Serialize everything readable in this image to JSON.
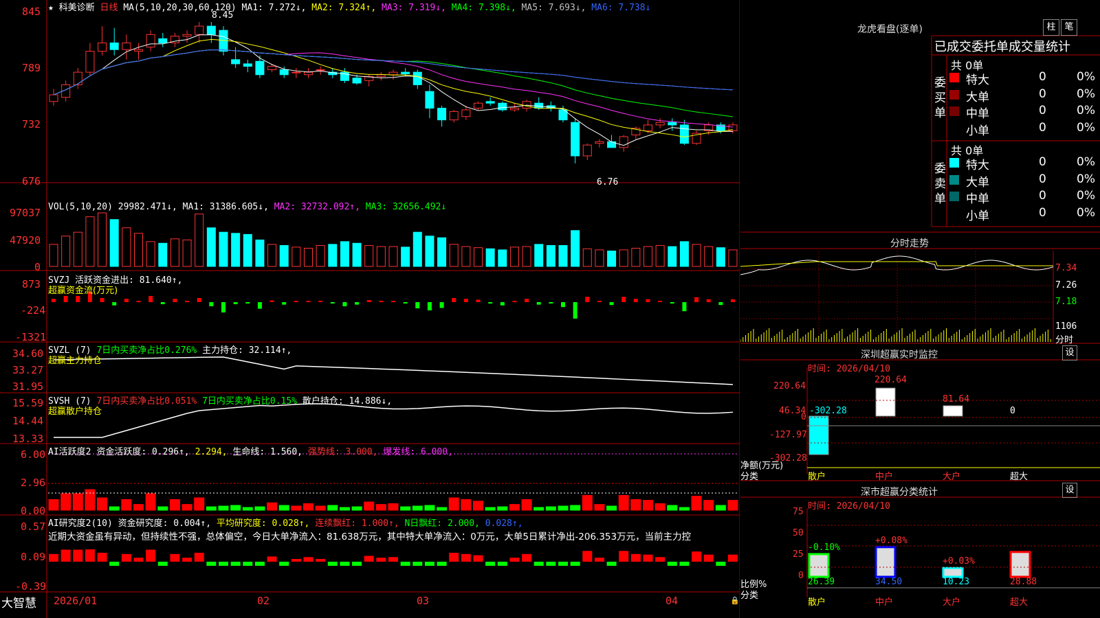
{
  "header": {
    "star": "★",
    "stock_name": "科美诊断",
    "period": "日线",
    "ma_label": "MA(5,10,20,30,60,120)",
    "ma1": "MA1: 7.272↓,",
    "ma2": "MA2: 7.324↑,",
    "ma3": "MA3: 7.319↓,",
    "ma4": "MA4: 7.398↓,",
    "ma5": "MA5: 7.693↓,",
    "ma6": "MA6: 7.738↓"
  },
  "price_axis": [
    "845",
    "789",
    "732",
    "676"
  ],
  "price_annotations": {
    "high": "8.45",
    "low": "6.76"
  },
  "vol": {
    "label": "VOL(5,10,20)",
    "value": "29982.471↓,",
    "ma1": "MA1: 31386.605↓,",
    "ma2": "MA2: 32732.092↑,",
    "ma3": "MA3: 32656.492↓",
    "axis": [
      "97037",
      "47920",
      "0"
    ]
  },
  "svzj": {
    "label": "SVZJ",
    "text1": "活跃资金进出: 81.640↑,",
    "text2": "超赢资金流(万元)",
    "axis": [
      "873",
      "-224",
      "-1321"
    ]
  },
  "svzl": {
    "label": "SVZL (7)",
    "text1": "7日内买卖净占比0.276%",
    "text2": "主力持仓: 32.114↑,",
    "text3": "超赢主力持仓",
    "axis": [
      "34.60",
      "33.27",
      "31.95"
    ]
  },
  "svsh": {
    "label": "SVSH (7)",
    "text1": "7日内买卖净占比0.051%",
    "text2": "7日内买卖净占比0.15%",
    "text3": "散户持仓: 14.886↓,",
    "text4": "超赢散户持仓",
    "axis": [
      "15.59",
      "14.44",
      "13.33"
    ]
  },
  "ai_active": {
    "label": "AI活跃度2",
    "text1": "资金活跃度: 0.296↑,",
    "text2": "2.294,",
    "text3": "生命线: 1.560,",
    "text4": "强势线: 3.000,",
    "text5": "爆发线: 6.000,",
    "axis": [
      "6.00",
      "2.96",
      "0.00"
    ]
  },
  "ai_research": {
    "label": "AI研究度2(10)",
    "text1": "资金研究度: 0.004↑,",
    "text2": "平均研究度: 0.028↑,",
    "text3": "连续飘红: 1.000↑,",
    "text4": "N日飘红: 2.000,",
    "text5": "0.028↑,",
    "comment": "近期大资金虽有异动，但持续性不强，总体偏空，今日大单净流入：81.638万元，其中特大单净流入：0万元，大单5日累计净出-206.353万元，当前主力控",
    "axis": [
      "0.57",
      "0.09",
      "-0.39"
    ]
  },
  "xaxis": {
    "brand": "大智慧",
    "labels": [
      "2026/01",
      "02",
      "03",
      "04"
    ]
  },
  "right": {
    "dragon_title": "龙虎看盘(逐单)",
    "btn_zhu": "柱",
    "btn_bi": "笔",
    "table_title": "已成交委托单成交量统计",
    "buy_label": "委买单",
    "sell_label": "委卖单",
    "buy_total": "共 0单",
    "sell_total": "共 0单",
    "buy_rows": [
      {
        "name": "特大",
        "val": "0",
        "pct": "0%",
        "color": "#ff0000"
      },
      {
        "name": "大单",
        "val": "0",
        "pct": "0%",
        "color": "#990000"
      },
      {
        "name": "中单",
        "val": "0",
        "pct": "0%",
        "color": "#770000"
      },
      {
        "name": "小单",
        "val": "0",
        "pct": "0%",
        "color": "#000000"
      }
    ],
    "sell_rows": [
      {
        "name": "特大",
        "val": "0",
        "pct": "0%",
        "color": "#00ffff"
      },
      {
        "name": "大单",
        "val": "0",
        "pct": "0%",
        "color": "#008888"
      },
      {
        "name": "中单",
        "val": "0",
        "pct": "0%",
        "color": "#006666"
      },
      {
        "name": "小单",
        "val": "0",
        "pct": "0%",
        "color": "#000000"
      }
    ],
    "fenshi_title": "分时走势",
    "fenshi_axis": [
      "7.34",
      "7.26",
      "7.18",
      "1106",
      "分时"
    ],
    "monitor_title": "深圳超赢实时监控",
    "btn_set1": "设",
    "monitor_time": "时间: 2026/04/10",
    "monitor_axis": [
      "220.64",
      "46.34",
      "0",
      "-127.97",
      "-302.28"
    ],
    "monitor_values": [
      "-302.28",
      "220.64",
      "81.64",
      "0"
    ],
    "monitor_ylabel": "净额(万元)",
    "monitor_xlabel": "分类",
    "categories": [
      "散户",
      "中户",
      "大户",
      "超大"
    ],
    "class_title": "深市超赢分类统计",
    "btn_set2": "设",
    "class_time": "时间: 2026/04/10",
    "class_axis": [
      "75",
      "50",
      "25",
      "0"
    ],
    "class_pct": [
      "-0.10%",
      "+0.08%",
      "+0.03%"
    ],
    "class_values": [
      "26.39",
      "34.50",
      "10.23",
      "28.88"
    ],
    "class_ylabel": "比例%",
    "class_xlabel": "分类"
  },
  "chart_data": {
    "type": "candlestick",
    "ohlc": [
      [
        7.5,
        7.65,
        7.45,
        7.58
      ],
      [
        7.55,
        7.75,
        7.5,
        7.7
      ],
      [
        7.7,
        7.9,
        7.65,
        7.85
      ],
      [
        7.85,
        8.2,
        7.8,
        8.1
      ],
      [
        8.1,
        8.4,
        8.05,
        8.2
      ],
      [
        8.2,
        8.38,
        8.05,
        8.12
      ],
      [
        8.12,
        8.3,
        8.0,
        8.2
      ],
      [
        8.1,
        8.2,
        8.0,
        8.12
      ],
      [
        8.15,
        8.35,
        8.1,
        8.3
      ],
      [
        8.25,
        8.32,
        8.15,
        8.2
      ],
      [
        8.2,
        8.32,
        8.15,
        8.28
      ],
      [
        8.28,
        8.35,
        8.2,
        8.3
      ],
      [
        8.3,
        8.45,
        8.2,
        8.4
      ],
      [
        8.4,
        8.45,
        8.2,
        8.3
      ],
      [
        8.35,
        8.4,
        8.05,
        8.1
      ],
      [
        8.0,
        8.15,
        7.9,
        7.95
      ],
      [
        7.95,
        8.0,
        7.85,
        7.92
      ],
      [
        7.98,
        8.05,
        7.78,
        7.82
      ],
      [
        7.88,
        7.95,
        7.85,
        7.92
      ],
      [
        7.88,
        7.92,
        7.78,
        7.82
      ],
      [
        7.85,
        7.9,
        7.78,
        7.85
      ],
      [
        7.82,
        7.9,
        7.78,
        7.85
      ],
      [
        7.88,
        7.92,
        7.82,
        7.88
      ],
      [
        7.85,
        7.9,
        7.78,
        7.82
      ],
      [
        7.85,
        7.9,
        7.72,
        7.75
      ],
      [
        7.78,
        7.82,
        7.7,
        7.72
      ],
      [
        7.75,
        7.82,
        7.68,
        7.8
      ],
      [
        7.8,
        7.85,
        7.75,
        7.82
      ],
      [
        7.82,
        7.88,
        7.76,
        7.85
      ],
      [
        7.85,
        7.9,
        7.8,
        7.83
      ],
      [
        7.85,
        7.88,
        7.65,
        7.7
      ],
      [
        7.62,
        7.7,
        7.3,
        7.42
      ],
      [
        7.42,
        7.45,
        7.2,
        7.28
      ],
      [
        7.28,
        7.4,
        7.25,
        7.38
      ],
      [
        7.32,
        7.45,
        7.28,
        7.4
      ],
      [
        7.42,
        7.5,
        7.4,
        7.48
      ],
      [
        7.5,
        7.55,
        7.45,
        7.48
      ],
      [
        7.48,
        7.5,
        7.38,
        7.4
      ],
      [
        7.4,
        7.48,
        7.38,
        7.42
      ],
      [
        7.42,
        7.52,
        7.38,
        7.5
      ],
      [
        7.48,
        7.55,
        7.4,
        7.42
      ],
      [
        7.45,
        7.5,
        7.38,
        7.42
      ],
      [
        7.4,
        7.45,
        7.25,
        7.28
      ],
      [
        7.25,
        7.3,
        6.76,
        6.85
      ],
      [
        6.85,
        7.0,
        6.8,
        6.98
      ],
      [
        7.0,
        7.05,
        6.95,
        7.02
      ],
      [
        7.02,
        7.1,
        6.95,
        6.95
      ],
      [
        6.95,
        7.1,
        6.9,
        7.08
      ],
      [
        7.1,
        7.2,
        7.05,
        7.18
      ],
      [
        7.15,
        7.28,
        7.12,
        7.22
      ],
      [
        7.22,
        7.3,
        7.18,
        7.25
      ],
      [
        7.25,
        7.3,
        7.15,
        7.22
      ],
      [
        7.22,
        7.28,
        6.98,
        7.0
      ],
      [
        7.0,
        7.15,
        6.98,
        7.12
      ],
      [
        7.15,
        7.25,
        7.1,
        7.22
      ],
      [
        7.22,
        7.25,
        7.12,
        7.15
      ],
      [
        7.15,
        7.25,
        7.12,
        7.22
      ]
    ],
    "volume": [
      40000,
      55000,
      62000,
      90000,
      97000,
      85000,
      70000,
      60000,
      45000,
      42000,
      50000,
      48000,
      95000,
      70000,
      62000,
      60000,
      58000,
      48000,
      40000,
      38000,
      35000,
      33000,
      38000,
      40000,
      45000,
      42000,
      38000,
      36000,
      36000,
      35000,
      62000,
      55000,
      52000,
      40000,
      36000,
      34000,
      32000,
      30000,
      35000,
      36000,
      40000,
      38000,
      38000,
      65000,
      32000,
      30000,
      28000,
      30000,
      33000,
      36000,
      38000,
      36000,
      45000,
      40000,
      36000,
      34000,
      30000
    ]
  }
}
